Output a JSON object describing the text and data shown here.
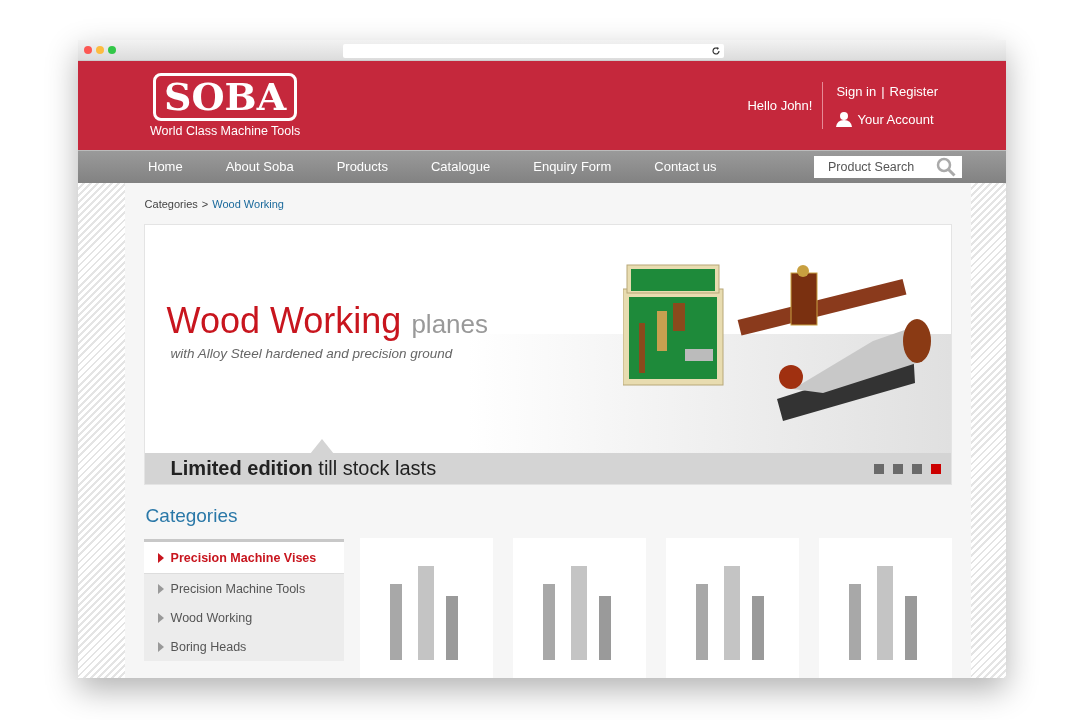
{
  "logo": {
    "wordmark": "SOBA",
    "tagline": "World Class Machine Tools"
  },
  "account": {
    "greeting": "Hello John!",
    "sign_in": "Sign in",
    "separator": "|",
    "register": "Register",
    "your_account": "Your Account"
  },
  "nav": {
    "items": [
      "Home",
      "About Soba",
      "Products",
      "Catalogue",
      "Enquiry Form",
      "Contact us"
    ],
    "search": {
      "placeholder": "Product Search"
    }
  },
  "breadcrumb": {
    "parent": "Categories",
    "separator": ">",
    "current": "Wood Working"
  },
  "banner": {
    "title": "Wood Working",
    "title_suffix": "planes",
    "subtitle": "with Alloy Steel hardened and precision ground",
    "strip": "**Limited edition** till stock lasts",
    "dots": [
      {
        "selected": false
      },
      {
        "selected": false
      },
      {
        "selected": false
      },
      {
        "selected": true
      }
    ]
  },
  "categories": {
    "heading": "Categories",
    "items": [
      {
        "label": "Precision Machine Vises",
        "selected": true
      },
      {
        "label": "Precision Machine Tools",
        "selected": false
      },
      {
        "label": "Wood Working",
        "selected": false
      },
      {
        "label": "Boring Heads",
        "selected": false
      }
    ]
  }
}
